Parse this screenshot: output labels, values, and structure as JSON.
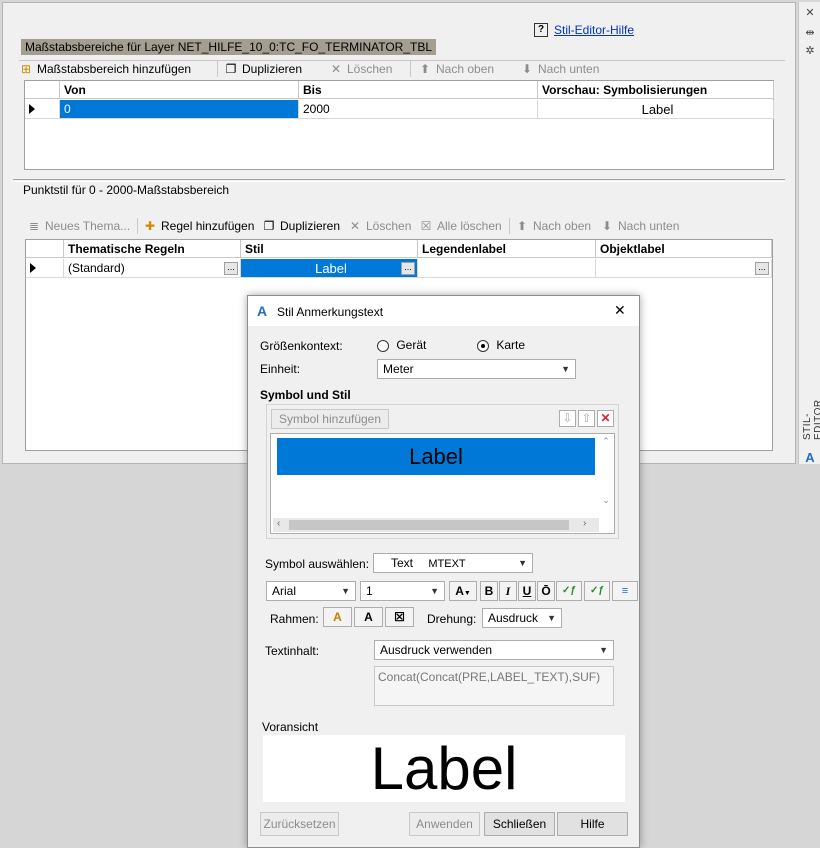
{
  "help": {
    "icon": "?",
    "link": "Stil-Editor-Hilfe"
  },
  "side": {
    "label": "STIL-EDITOR",
    "logo": "A",
    "close": "✕",
    "pin": "⇹",
    "gear": "✲"
  },
  "scale_section": {
    "title": "Maßstabsbereiche für Layer NET_HILFE_10_0:TC_FO_TERMINATOR_TBL",
    "toolbar": {
      "add": "Maßstabsbereich hinzufügen",
      "duplicate": "Duplizieren",
      "delete": "Löschen",
      "up": "Nach oben",
      "down": "Nach unten"
    },
    "columns": [
      "Von",
      "Bis",
      "Vorschau: Symbolisierungen"
    ],
    "rows": [
      {
        "von": "0",
        "bis": "2000",
        "preview": "Label"
      }
    ]
  },
  "point_section": {
    "title": "Punktstil für 0 - 2000-Maßstabsbereich",
    "toolbar": {
      "new_theme": "Neues Thema...",
      "add_rule": "Regel hinzufügen",
      "duplicate": "Duplizieren",
      "delete": "Löschen",
      "delete_all": "Alle löschen",
      "up": "Nach oben",
      "down": "Nach unten"
    },
    "columns": [
      "Thematische Regeln",
      "Stil",
      "Legendenlabel",
      "Objektlabel"
    ],
    "rows": [
      {
        "rule": "(Standard)",
        "style": "Label",
        "legend": "",
        "object": ""
      }
    ],
    "ellipsis": "..."
  },
  "dialog": {
    "title": "Stil Anmerkungstext",
    "close": "✕",
    "size_context_label": "Größenkontext:",
    "radio_device": "Gerät",
    "radio_map": "Karte",
    "radio_selected": "Karte",
    "unit_label": "Einheit:",
    "unit_value": "Meter",
    "symbol_heading": "Symbol und Stil",
    "add_symbol": "Symbol hinzufügen",
    "symbol_list_item": "Label",
    "select_symbol_label": "Symbol auswählen:",
    "symbol_type": "Text",
    "symbol_subtype": "MTEXT",
    "font": "Arial",
    "size": "1",
    "frame_label": "Rahmen:",
    "rotation_label": "Drehung:",
    "rotation_value": "Ausdruck",
    "content_label": "Textinhalt:",
    "content_mode": "Ausdruck verwenden",
    "expression": "Concat(Concat(PRE,LABEL_TEXT),SUF)",
    "preview_label": "Voransicht",
    "preview_text": "Label",
    "buttons": {
      "reset": "Zurücksetzen",
      "apply": "Anwenden",
      "close": "Schließen",
      "help": "Hilfe"
    }
  },
  "colors": {
    "selection": "#0078d7",
    "section_bar": "#a39e8f",
    "accent": "#1f6fc5"
  }
}
